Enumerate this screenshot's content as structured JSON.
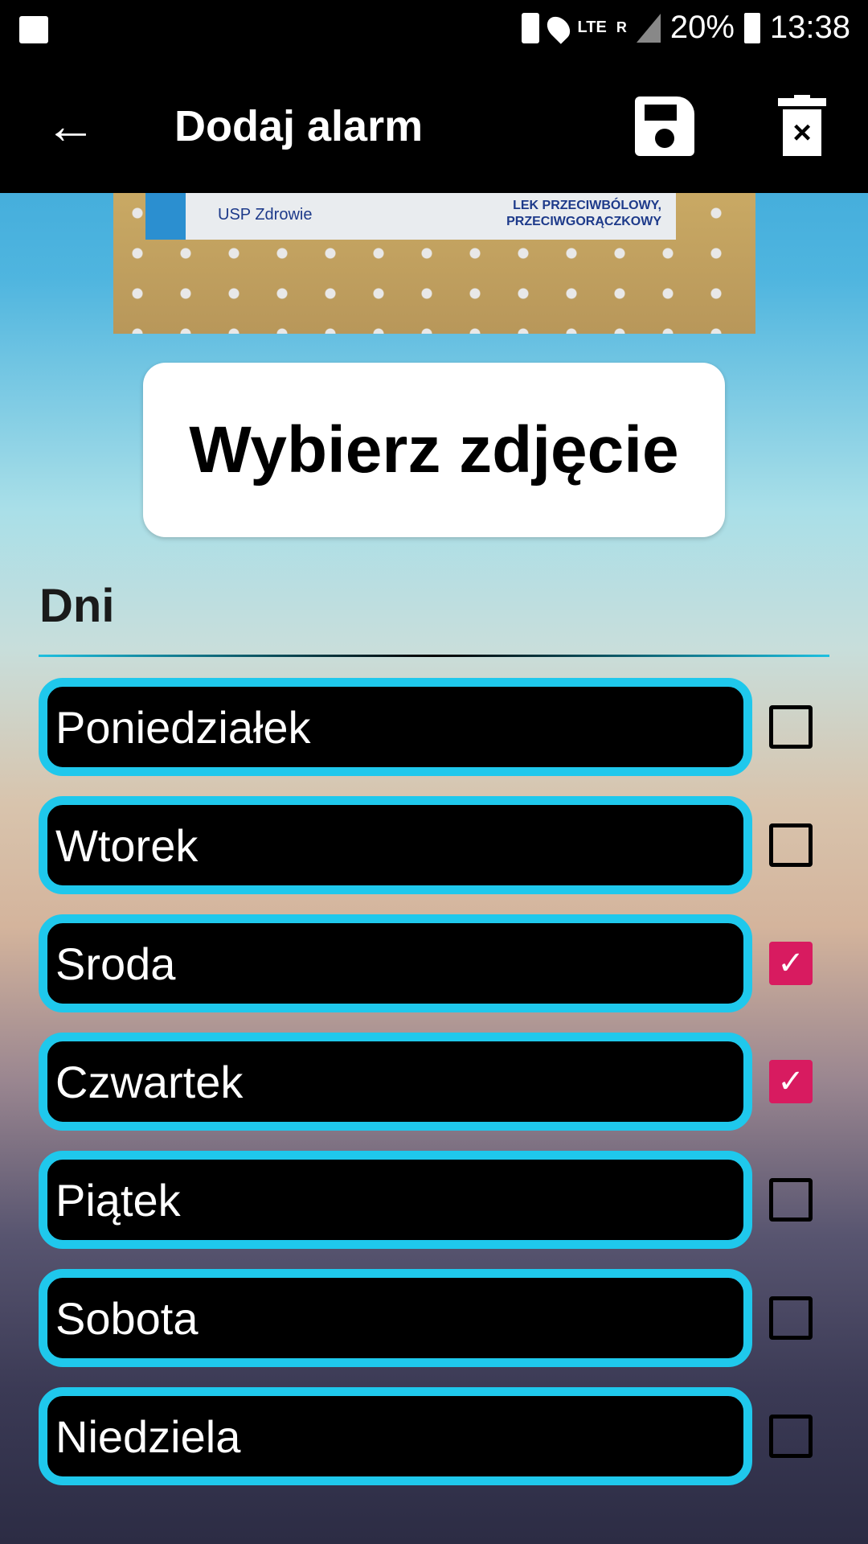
{
  "status_bar": {
    "battery": "20%",
    "time": "13:38",
    "network": "LTE",
    "roaming": "R"
  },
  "toolbar": {
    "title": "Dodaj alarm",
    "back_icon": "arrow-back-icon",
    "save_icon": "save-icon",
    "delete_icon": "delete-icon"
  },
  "photo": {
    "brand": "USP Zdrowie",
    "label_line1": "LEK PRZECIWBÓLOWY,",
    "label_line2": "PRZECIWGORĄCZKOWY"
  },
  "pick_photo_label": "Wybierz zdjęcie",
  "days_heading": "Dni",
  "days": [
    {
      "label": "Poniedziałek",
      "checked": false
    },
    {
      "label": "Wtorek",
      "checked": false
    },
    {
      "label": "Sroda",
      "checked": true
    },
    {
      "label": "Czwartek",
      "checked": true
    },
    {
      "label": "Piątek",
      "checked": false
    },
    {
      "label": "Sobota",
      "checked": false
    },
    {
      "label": "Niedziela",
      "checked": false
    }
  ],
  "colors": {
    "accent": "#1fc8ec",
    "checkbox_checked": "#d81b60"
  }
}
